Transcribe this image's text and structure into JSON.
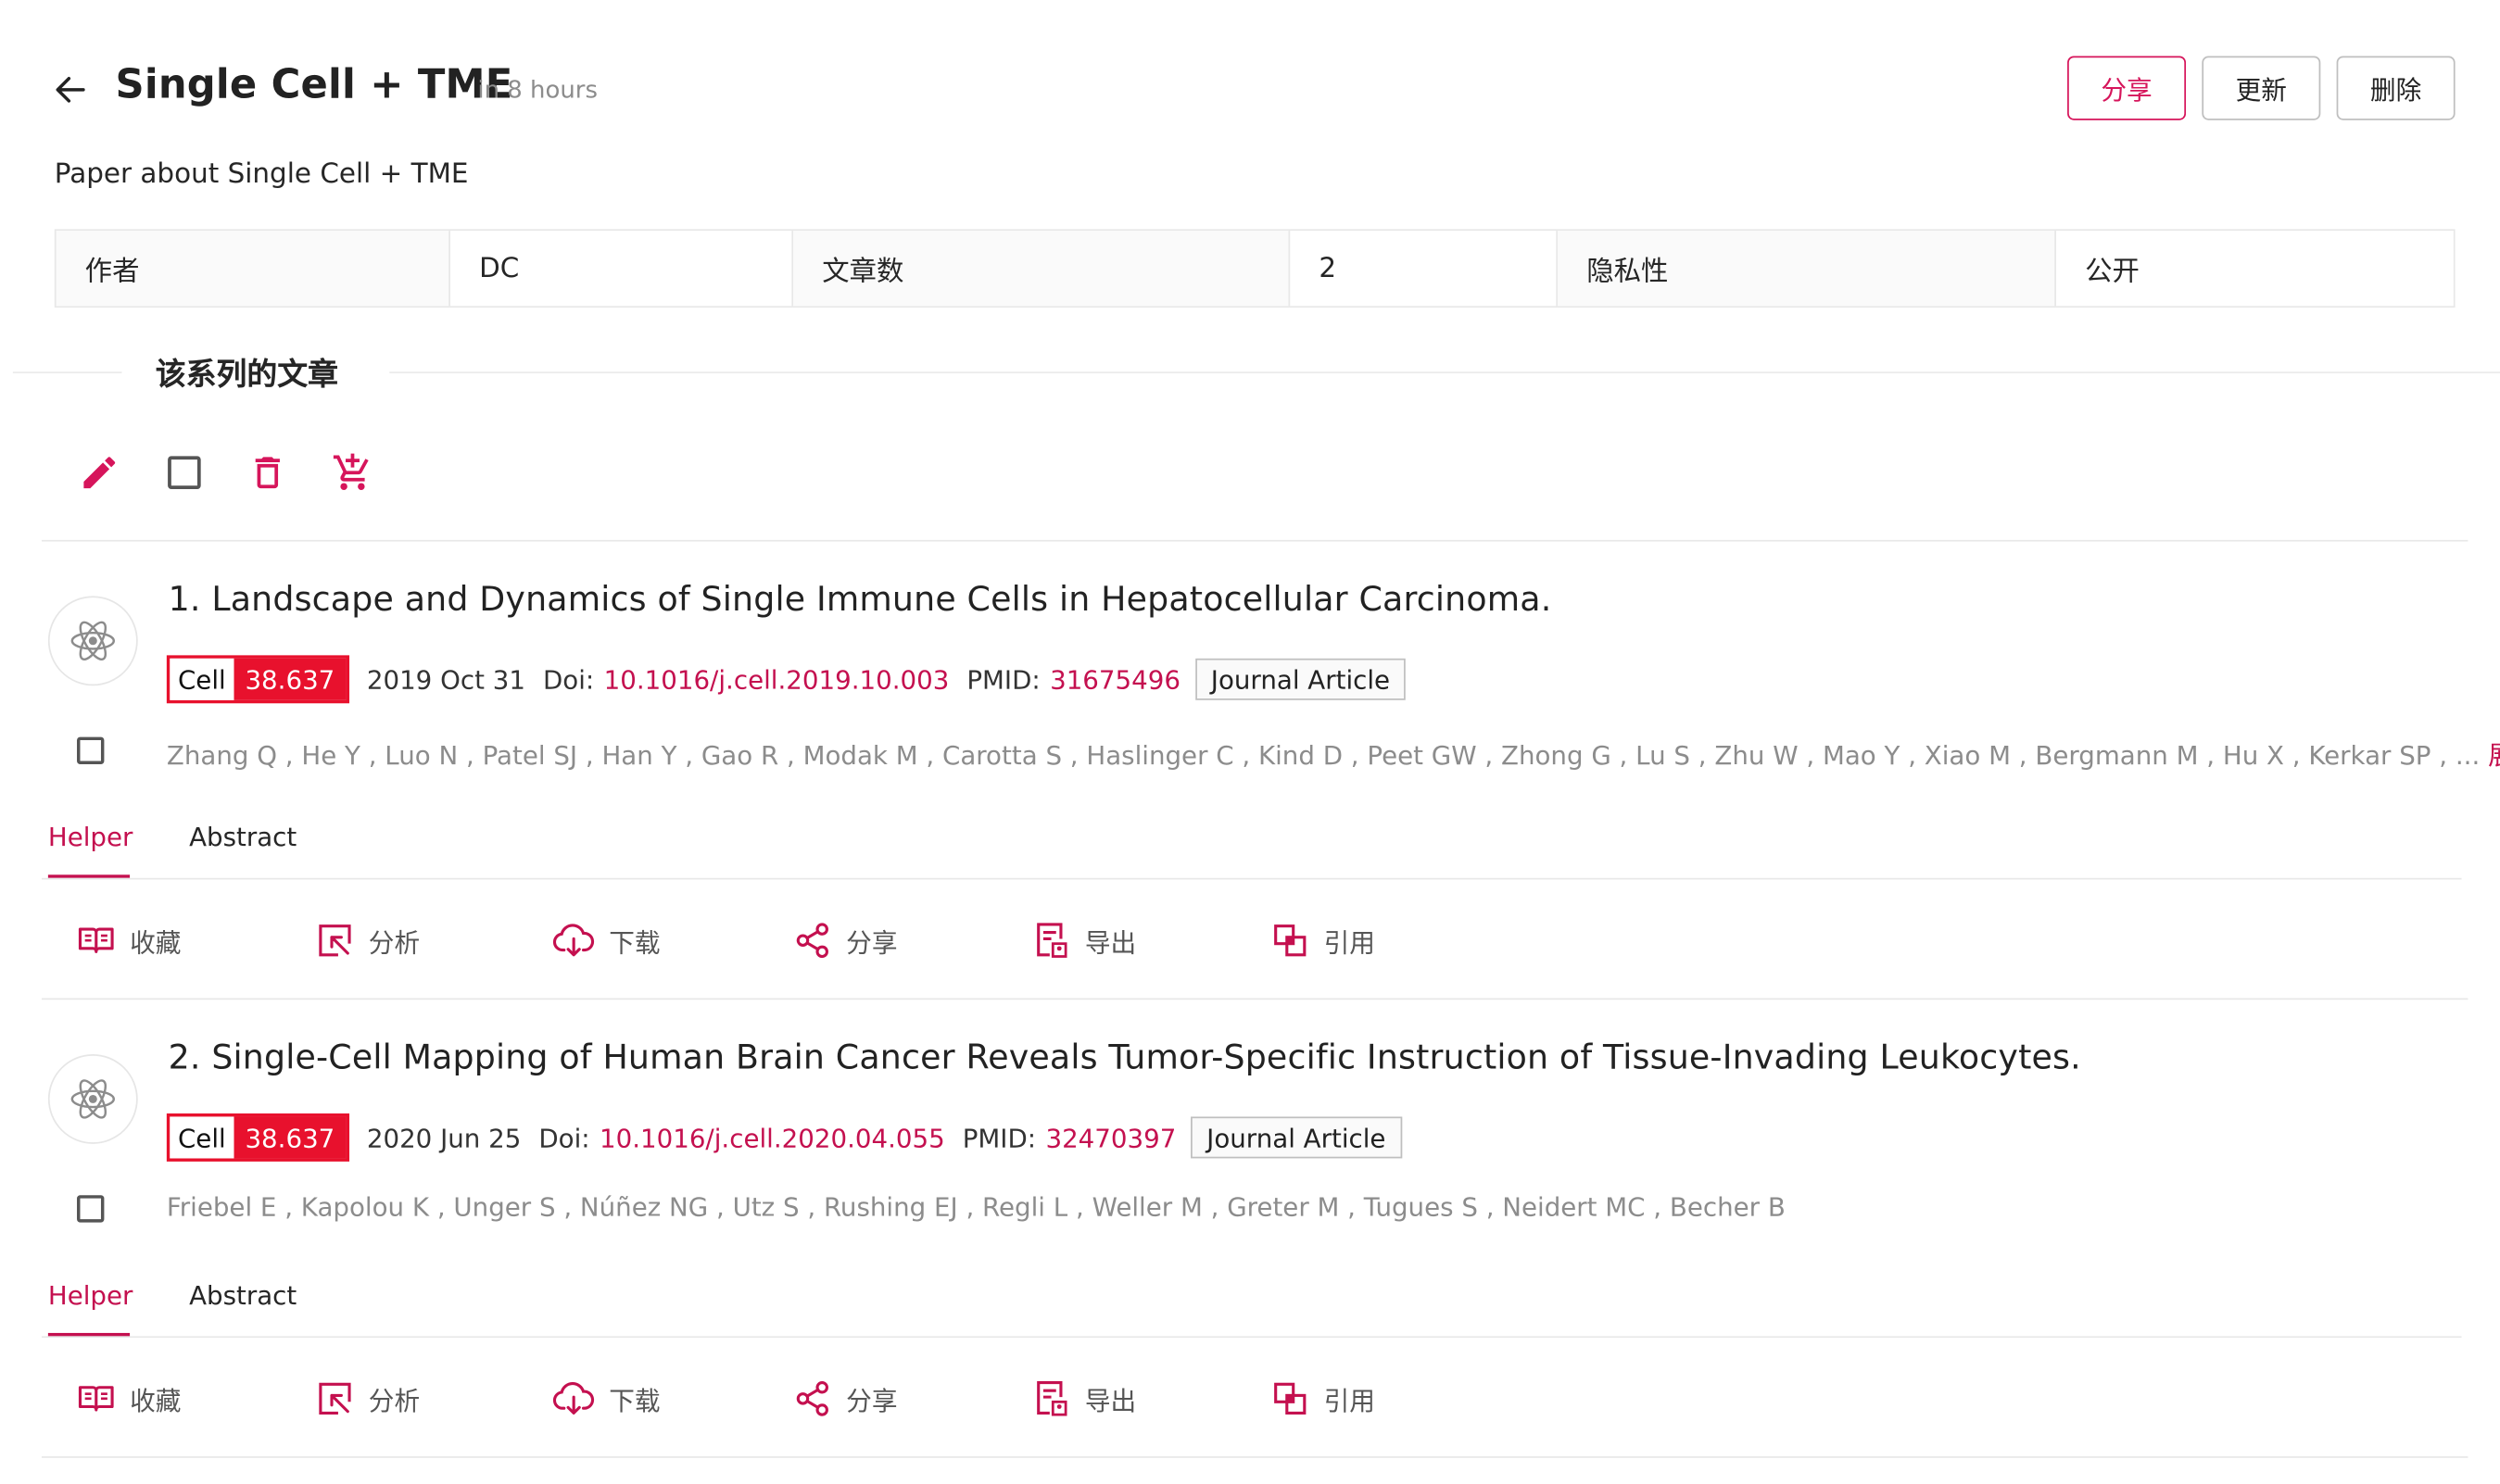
{
  "header": {
    "title": "Single Cell + TME",
    "time": "in 8 hours",
    "description": "Paper about Single Cell + TME",
    "buttons": {
      "share": "分享",
      "update": "更新",
      "delete": "删除"
    }
  },
  "info": {
    "author_label": "作者",
    "author_value": "DC",
    "count_label": "文章数",
    "count_value": "2",
    "privacy_label": "隐私性",
    "privacy_value": "公开"
  },
  "section_title": "该系列的文章",
  "toolbar_icons": [
    "edit-icon",
    "checkbox-icon",
    "trash-icon",
    "cart-add-icon"
  ],
  "articles": [
    {
      "title": "1. Landscape and Dynamics of Single Immune Cells in Hepatocellular Carcinoma.",
      "journal": "Cell",
      "impact": "38.637",
      "date": "2019 Oct 31",
      "doi_label": "Doi:",
      "doi": "10.1016/j.cell.2019.10.003",
      "pmid_label": "PMID:",
      "pmid": "31675496",
      "type": "Journal Article",
      "authors": "Zhang Q , He Y , Luo N , Patel SJ , Han Y , Gao R , Modak M , Carotta S , Haslinger C , Kind D , Peet GW , Zhong G , Lu S , Zhu W , Mao Y , Xiao M , Bergmann M , Hu X , Kerkar SP , ...",
      "expand": "展开",
      "tabs": [
        "Helper",
        "Abstract"
      ]
    },
    {
      "title": "2. Single-Cell Mapping of Human Brain Cancer Reveals Tumor-Specific Instruction of Tissue-Invading Leukocytes.",
      "journal": "Cell",
      "impact": "38.637",
      "date": "2020 Jun 25",
      "doi_label": "Doi:",
      "doi": "10.1016/j.cell.2020.04.055",
      "pmid_label": "PMID:",
      "pmid": "32470397",
      "type": "Journal Article",
      "authors": "Friebel E , Kapolou K , Unger S , Núñez NG , Utz S , Rushing EJ , Regli L , Weller M , Greter M , Tugues S , Neidert MC , Becher B",
      "expand": "",
      "tabs": [
        "Helper",
        "Abstract"
      ]
    }
  ],
  "actions": [
    "收藏",
    "分析",
    "下载",
    "分享",
    "导出",
    "引用"
  ],
  "colors": {
    "accent": "#c4104f",
    "journal_red": "#e8112d"
  }
}
